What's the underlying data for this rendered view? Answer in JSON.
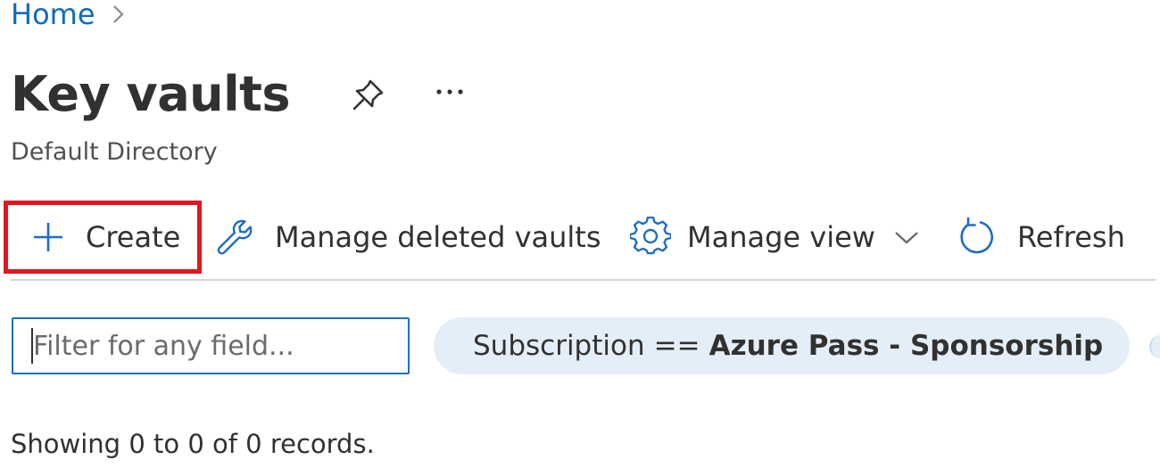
{
  "breadcrumb": {
    "home": "Home"
  },
  "page": {
    "title": "Key vaults",
    "subtitle": "Default Directory"
  },
  "icons": {
    "pin": "pin-icon",
    "more": "more-icon",
    "plus": "plus-icon",
    "wrench": "wrench-icon",
    "gear": "gear-icon",
    "chevron": "chevron-down-icon",
    "refresh": "refresh-icon"
  },
  "toolbar": {
    "create_label": "Create",
    "manage_deleted_label": "Manage deleted vaults",
    "manage_view_label": "Manage view",
    "refresh_label": "Refresh"
  },
  "filter": {
    "placeholder": "Filter for any field...",
    "value": ""
  },
  "subscription_filter": {
    "key": "Subscription",
    "operator": "==",
    "value": "Azure Pass - Sponsorship"
  },
  "status": {
    "records_text": "Showing 0 to 0 of 0 records."
  },
  "colors": {
    "link": "#0f6cbd",
    "highlight_border": "#e3161f",
    "input_border": "#1f6cc4",
    "pill_background": "#e4eef8",
    "icon_blue": "#1f6cc4"
  }
}
